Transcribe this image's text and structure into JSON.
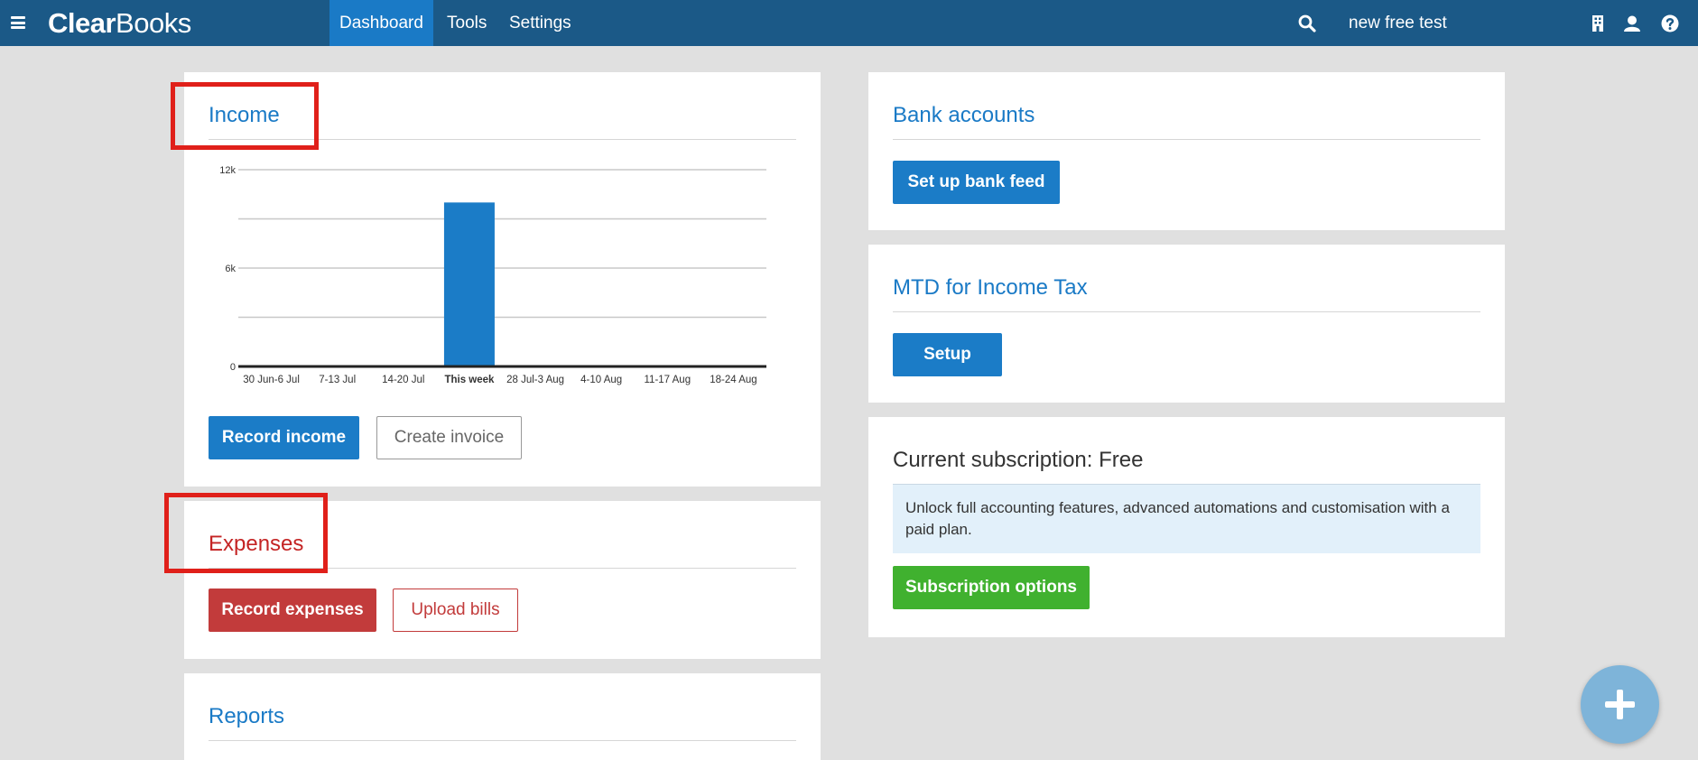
{
  "header": {
    "logo_bold": "Clear",
    "logo_light": "Books",
    "tabs": [
      {
        "label": "Dashboard",
        "active": true
      },
      {
        "label": "Tools",
        "active": false
      },
      {
        "label": "Settings",
        "active": false
      }
    ],
    "company_name": "new free test"
  },
  "income": {
    "title": "Income",
    "record_label": "Record income",
    "invoice_label": "Create invoice"
  },
  "expenses": {
    "title": "Expenses",
    "record_label": "Record expenses",
    "upload_label": "Upload bills"
  },
  "reports": {
    "title": "Reports"
  },
  "bank": {
    "title": "Bank accounts",
    "button_label": "Set up bank feed"
  },
  "mtd": {
    "title": "MTD for Income Tax",
    "button_label": "Setup"
  },
  "subscription": {
    "title": "Current subscription: Free",
    "notice": "Unlock full accounting features, advanced automations and customisation with a paid plan.",
    "button_label": "Subscription options"
  },
  "colors": {
    "topbar": "#1b5987",
    "accent_blue": "#1a7ac6",
    "expense_red": "#c23b3b",
    "success_green": "#40b12f",
    "highlight_red": "#e0201a"
  },
  "chart_data": {
    "type": "bar",
    "categories": [
      "30 Jun-6 Jul",
      "7-13 Jul",
      "14-20 Jul",
      "This week",
      "28 Jul-3 Aug",
      "4-10 Aug",
      "11-17 Aug",
      "18-24 Aug"
    ],
    "values": [
      0,
      0,
      0,
      10000,
      0,
      0,
      0,
      0
    ],
    "highlight_category": "This week",
    "ylim": [
      0,
      12000
    ],
    "ytick_labels": [
      "0",
      "6k",
      "12k"
    ],
    "ytick_values": [
      0,
      6000,
      12000
    ],
    "gridlines": [
      0,
      3000,
      6000,
      9000,
      12000
    ],
    "grid": true,
    "title": "",
    "xlabel": "",
    "ylabel": ""
  }
}
